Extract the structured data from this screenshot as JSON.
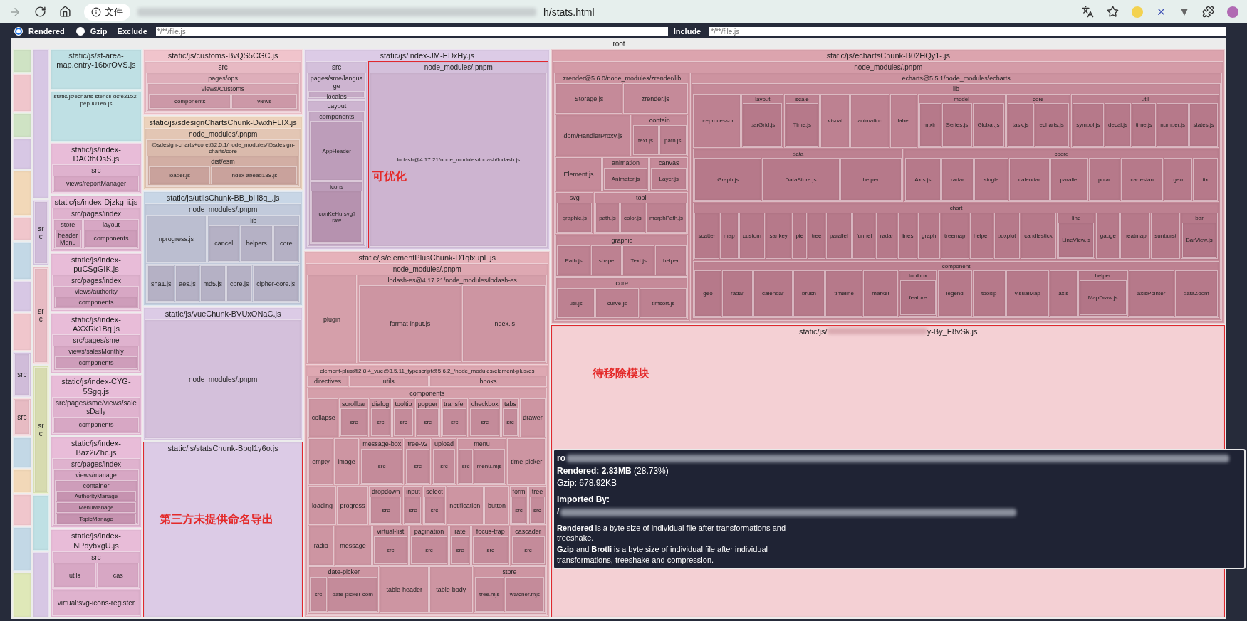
{
  "browser": {
    "scheme_label": "文件",
    "url_end": "h/stats.html"
  },
  "controls": {
    "modes": [
      {
        "label": "Rendered",
        "selected": true
      },
      {
        "label": "Gzip",
        "selected": false
      }
    ],
    "exclude": {
      "label": "Exclude",
      "placeholder": "*/**/file.js"
    },
    "include": {
      "label": "Include",
      "placeholder": "*/**/file.js"
    }
  },
  "treemap": {
    "name": "root",
    "children": [
      {
        "color": "#cfe3c4"
      },
      {
        "color": "#f0c6cc"
      },
      {
        "color": "#cfe3c4"
      },
      {
        "color": "#d7c7e4"
      },
      {
        "color": "#f2d8b8"
      },
      {
        "color": "#f0c6cc"
      },
      {
        "color": "#c3d8e6"
      },
      {
        "color": "#d7c7e4"
      },
      {
        "color": "#f0c6cc"
      },
      {
        "color": "#d7c7e4",
        "children": [
          {
            "name": "src"
          }
        ]
      },
      {
        "color": "#f0c6cc",
        "children": [
          {
            "name": "src"
          }
        ]
      },
      {
        "color": "#c3d8e6"
      },
      {
        "color": "#f2d8b8"
      },
      {
        "color": "#f0c6cc"
      },
      {
        "color": "#c3d8e6"
      },
      {
        "color": "#dfe8b8"
      },
      {
        "color": "#d7c7e4"
      },
      {
        "color": "#d7c7e4",
        "children": [
          {
            "name": "src"
          }
        ]
      },
      {
        "color": "#f0c6cc",
        "children": [
          {
            "name": "src"
          }
        ]
      },
      {
        "color": "#dfe8b8",
        "children": [
          {
            "name": "src"
          }
        ]
      },
      {
        "color": "#bfe0e4"
      },
      {
        "color": "#d7c7e4"
      },
      {
        "name": "static/js/sf-area-map.entry-16txrOVS.js",
        "color": "#bfe0e4"
      },
      {
        "name": "static/js/echarts-stencil-dcfe3152-pep0U1e6.js",
        "color": "#bfe0e4"
      },
      {
        "name": "static/js/index-DACfhOsS.js",
        "color": "#e8bcd8",
        "children": [
          {
            "name": "src",
            "children": [
              {
                "name": "views/reportManager"
              }
            ]
          }
        ]
      },
      {
        "name": "static/js/index-Djzkg-ii.js",
        "color": "#e8bcd8",
        "children": [
          {
            "name": "src/pages/index",
            "children": [
              {
                "name": "store",
                "children": [
                  {
                    "name": "headerMenu"
                  }
                ]
              },
              {
                "name": "layout",
                "children": [
                  {
                    "name": "components"
                  }
                ]
              }
            ]
          }
        ]
      },
      {
        "name": "static/js/index-puCSgGIK.js",
        "color": "#e8bcd8",
        "children": [
          {
            "name": "src/pages/index",
            "children": [
              {
                "name": "views/authority",
                "children": [
                  {
                    "name": "components"
                  }
                ]
              }
            ]
          }
        ]
      },
      {
        "name": "static/js/index-AXXRk1Bq.js",
        "color": "#e8bcd8",
        "children": [
          {
            "name": "src/pages/sme",
            "children": [
              {
                "name": "views/salesMonthly",
                "children": [
                  {
                    "name": "components"
                  }
                ]
              }
            ]
          }
        ]
      },
      {
        "name": "static/js/index-CYG-5Sgq.js",
        "color": "#e8bcd8",
        "children": [
          {
            "name": "src/pages/sme/views/salesDaily",
            "children": [
              {
                "name": "components"
              }
            ]
          }
        ]
      },
      {
        "name": "static/js/index-Baz2iZhc.js",
        "color": "#e8bcd8",
        "children": [
          {
            "name": "src/pages/index",
            "children": [
              {
                "name": "views/manage",
                "children": [
                  {
                    "name": "container",
                    "children": [
                      {
                        "name": "AuthorityManage"
                      },
                      {
                        "name": "MenuManage"
                      },
                      {
                        "name": "TopicManage"
                      }
                    ]
                  }
                ]
              }
            ]
          }
        ]
      },
      {
        "name": "static/js/index-NPdybxgU.js",
        "color": "#e8bcd8",
        "children": [
          {
            "name": "src",
            "children": [
              {
                "name": "utils"
              },
              {
                "name": "cas"
              }
            ]
          },
          {
            "name": "virtual:svg-icons-register"
          }
        ]
      },
      {
        "name": "static/js/customs-BvQS5CGC.js",
        "color": "#f0c4cc",
        "children": [
          {
            "name": "src",
            "children": [
              {
                "name": "pages/ops",
                "children": [
                  {
                    "name": "views/Customs",
                    "children": [
                      {
                        "name": "components"
                      },
                      {
                        "name": "views"
                      }
                    ]
                  }
                ]
              }
            ]
          }
        ]
      },
      {
        "name": "static/js/sdesignChartsChunk-DwxhFLIX.js",
        "color": "#ecd2bc",
        "children": [
          {
            "name": "node_modules/.pnpm",
            "children": [
              {
                "name": "@sdesign-charts+core@2.5.1/node_modules/@sdesign-charts/core",
                "children": [
                  {
                    "name": "dist/esm",
                    "children": [
                      {
                        "name": "loader.js"
                      },
                      {
                        "name": "index-abead138.js"
                      }
                    ]
                  }
                ]
              }
            ]
          }
        ]
      },
      {
        "name": "static/js/utilsChunk-BB_bH8q_.js",
        "color": "#c8d6e6",
        "children": [
          {
            "name": "node_modules/.pnpm",
            "children": [
              {
                "name": "nprogress.js"
              },
              {
                "name": "lib",
                "children": [
                  {
                    "name": "cancel"
                  },
                  {
                    "name": "helpers"
                  },
                  {
                    "name": "core"
                  }
                ]
              },
              {
                "children": [
                  {
                    "name": "sha1.js"
                  },
                  {
                    "name": "aes.js"
                  },
                  {
                    "name": "md5.js"
                  },
                  {
                    "name": "core.js"
                  },
                  {
                    "name": "cipher-core.js"
                  }
                ]
              }
            ]
          }
        ]
      },
      {
        "name": "static/js/vueChunk-BVUxONaC.js",
        "color": "#dccbe6",
        "children": [
          {
            "name": "node_modules/.pnpm"
          }
        ]
      },
      {
        "name": "static/js/statsChunk-Bpql1y6o.js",
        "color": "#dccbe6",
        "highlighted": true,
        "note": "第三方未提供命名导出"
      },
      {
        "name": "static/js/index-JM-EDxHy.js",
        "color": "#dccbe6",
        "children": [
          {
            "name": "src",
            "children": [
              {
                "name": "pages/sme/language",
                "children": [
                  {
                    "name": "locales"
                  }
                ]
              },
              {
                "name": "Layout",
                "children": [
                  {
                    "name": "components",
                    "children": [
                      {
                        "name": "AppHeader"
                      },
                      {
                        "name": "icons",
                        "children": [
                          {
                            "name": "iconKeHu.svg?raw"
                          }
                        ]
                      }
                    ]
                  }
                ]
              }
            ]
          },
          {
            "name": "node_modules/.pnpm",
            "highlighted": true,
            "note": "可优化",
            "children": [
              {
                "name": "lodash@4.17.21/node_modules/lodash/lodash.js"
              }
            ]
          }
        ]
      },
      {
        "name": "static/js/elementPlusChunk-D1qlxupF.js",
        "color": "#e6b2ba",
        "children": [
          {
            "name": "node_modules/.pnpm",
            "children": [
              {
                "name": "plugin"
              },
              {
                "name": "lodash-es@4.17.21/node_modules/lodash-es",
                "children": [
                  {
                    "name": "format-input.js"
                  },
                  {
                    "name": "index.js"
                  }
                ]
              }
            ]
          },
          {
            "name": "element-plus@2.8.4_vue@3.5.11_typescript@5.6.2_/node_modules/element-plus/es",
            "children": [
              {
                "name": "directives"
              },
              {
                "name": "utils"
              },
              {
                "name": "hooks"
              },
              {
                "name": "components",
                "children": [
                  {
                    "name": "collapse"
                  },
                  {
                    "name": "scrollbar",
                    "children": [
                      {
                        "name": "src"
                      }
                    ]
                  },
                  {
                    "name": "dialog",
                    "children": [
                      {
                        "name": "src"
                      }
                    ]
                  },
                  {
                    "name": "tooltip",
                    "children": [
                      {
                        "name": "src"
                      }
                    ]
                  },
                  {
                    "name": "popper",
                    "children": [
                      {
                        "name": "src"
                      }
                    ]
                  },
                  {
                    "name": "transfer",
                    "children": [
                      {
                        "name": "src"
                      }
                    ]
                  },
                  {
                    "name": "checkbox",
                    "children": [
                      {
                        "name": "src"
                      }
                    ]
                  },
                  {
                    "name": "tabs",
                    "children": [
                      {
                        "name": "src"
                      }
                    ]
                  },
                  {
                    "name": "drawer"
                  },
                  {
                    "name": "empty"
                  },
                  {
                    "name": "image"
                  },
                  {
                    "name": "message-box",
                    "children": [
                      {
                        "name": "src"
                      }
                    ]
                  },
                  {
                    "name": "tree-v2",
                    "children": [
                      {
                        "name": "src"
                      }
                    ]
                  },
                  {
                    "name": "upload",
                    "children": [
                      {
                        "name": "src"
                      }
                    ]
                  },
                  {
                    "name": "menu",
                    "children": [
                      {
                        "name": "src"
                      },
                      {
                        "name": "menu.mjs"
                      }
                    ]
                  },
                  {
                    "name": "time-picker"
                  },
                  {
                    "name": "loading"
                  },
                  {
                    "name": "progress"
                  },
                  {
                    "name": "dropdown",
                    "children": [
                      {
                        "name": "src"
                      }
                    ]
                  },
                  {
                    "name": "input",
                    "children": [
                      {
                        "name": "src"
                      }
                    ]
                  },
                  {
                    "name": "select",
                    "children": [
                      {
                        "name": "src"
                      }
                    ]
                  },
                  {
                    "name": "notification"
                  },
                  {
                    "name": "button"
                  },
                  {
                    "name": "form",
                    "children": [
                      {
                        "name": "src"
                      }
                    ]
                  },
                  {
                    "name": "tree",
                    "children": [
                      {
                        "name": "src"
                      }
                    ]
                  },
                  {
                    "name": "radio"
                  },
                  {
                    "name": "message"
                  },
                  {
                    "name": "virtual-list",
                    "children": [
                      {
                        "name": "src"
                      }
                    ]
                  },
                  {
                    "name": "pagination",
                    "children": [
                      {
                        "name": "src"
                      }
                    ]
                  },
                  {
                    "name": "rate",
                    "children": [
                      {
                        "name": "src"
                      }
                    ]
                  },
                  {
                    "name": "focus-trap",
                    "children": [
                      {
                        "name": "src"
                      }
                    ]
                  },
                  {
                    "name": "cascader",
                    "children": [
                      {
                        "name": "src"
                      }
                    ]
                  },
                  {
                    "name": "date-picker",
                    "children": [
                      {
                        "name": "src"
                      },
                      {
                        "name": "date-picker-com"
                      }
                    ]
                  },
                  {
                    "name": "table-header"
                  },
                  {
                    "name": "table-body"
                  },
                  {
                    "name": "store",
                    "children": [
                      {
                        "name": "tree.mjs"
                      },
                      {
                        "name": "watcher.mjs"
                      }
                    ]
                  }
                ]
              }
            ]
          }
        ]
      },
      {
        "name": "static/js/echartsChunk-B02HQy1-.js",
        "color": "#dca4ae",
        "children": [
          {
            "name": "node_modules/.pnpm",
            "children": [
              {
                "name": "zrender@5.6.0/node_modules/zrender/lib",
                "children": [
                  {
                    "name": "Storage.js"
                  },
                  {
                    "name": "zrender.js"
                  },
                  {
                    "name": "dom/HandlerProxy.js"
                  },
                  {
                    "name": "contain",
                    "children": [
                      {
                        "name": "text.js"
                      },
                      {
                        "name": "path.js"
                      }
                    ]
                  },
                  {
                    "name": "Element.js"
                  },
                  {
                    "name": "animation",
                    "children": [
                      {
                        "name": "Animator.js"
                      }
                    ]
                  },
                  {
                    "name": "canvas",
                    "children": [
                      {
                        "name": "Layer.js"
                      }
                    ]
                  },
                  {
                    "name": "svg",
                    "children": [
                      {
                        "name": "graphic.js"
                      }
                    ]
                  },
                  {
                    "name": "tool",
                    "children": [
                      {
                        "name": "path.js"
                      },
                      {
                        "name": "color.js"
                      },
                      {
                        "name": "morphPath.js"
                      }
                    ]
                  },
                  {
                    "name": "graphic",
                    "children": [
                      {
                        "name": "Path.js"
                      },
                      {
                        "name": "shape"
                      },
                      {
                        "name": "Text.js"
                      },
                      {
                        "name": "helper"
                      }
                    ]
                  },
                  {
                    "name": "core",
                    "children": [
                      {
                        "name": "util.js"
                      },
                      {
                        "name": "curve.js"
                      },
                      {
                        "name": "timsort.js"
                      }
                    ]
                  }
                ]
              },
              {
                "name": "echarts@5.5.1/node_modules/echarts",
                "children": [
                  {
                    "name": "lib",
                    "children": [
                      {
                        "name": "preprocessor"
                      },
                      {
                        "name": "layout",
                        "children": [
                          {
                            "name": "barGrid.js"
                          }
                        ]
                      },
                      {
                        "name": "scale",
                        "children": [
                          {
                            "name": "Time.js"
                          }
                        ]
                      },
                      {
                        "name": "visual"
                      },
                      {
                        "name": "animation"
                      },
                      {
                        "name": "label"
                      },
                      {
                        "name": "model",
                        "children": [
                          {
                            "name": "mixin"
                          },
                          {
                            "name": "Series.js"
                          },
                          {
                            "name": "Global.js"
                          }
                        ]
                      },
                      {
                        "name": "core",
                        "children": [
                          {
                            "name": "task.js"
                          },
                          {
                            "name": "echarts.js"
                          }
                        ]
                      },
                      {
                        "name": "util",
                        "children": [
                          {
                            "name": "symbol.js"
                          },
                          {
                            "name": "decal.js"
                          },
                          {
                            "name": "time.js"
                          },
                          {
                            "name": "number.js"
                          },
                          {
                            "name": "states.js"
                          }
                        ]
                      },
                      {
                        "name": "data",
                        "children": [
                          {
                            "name": "Graph.js"
                          },
                          {
                            "name": "DataStore.js"
                          },
                          {
                            "name": "helper"
                          }
                        ]
                      },
                      {
                        "name": "coord",
                        "children": [
                          {
                            "name": "Axis.js"
                          },
                          {
                            "name": "radar"
                          },
                          {
                            "name": "single"
                          },
                          {
                            "name": "calendar"
                          },
                          {
                            "name": "parallel"
                          },
                          {
                            "name": "polar"
                          },
                          {
                            "name": "cartesian"
                          },
                          {
                            "name": "geo"
                          },
                          {
                            "name": "fix"
                          }
                        ]
                      },
                      {
                        "name": "chart",
                        "children": [
                          {
                            "name": "scatter"
                          },
                          {
                            "name": "map"
                          },
                          {
                            "name": "custom"
                          },
                          {
                            "name": "sankey"
                          },
                          {
                            "name": "pie"
                          },
                          {
                            "name": "tree"
                          },
                          {
                            "name": "parallel"
                          },
                          {
                            "name": "funnel"
                          },
                          {
                            "name": "radar"
                          },
                          {
                            "name": "lines"
                          },
                          {
                            "name": "graph"
                          },
                          {
                            "name": "treemap"
                          },
                          {
                            "name": "helper"
                          },
                          {
                            "name": "boxplot"
                          },
                          {
                            "name": "candlestick"
                          },
                          {
                            "name": "line",
                            "children": [
                              {
                                "name": "LineView.js"
                              }
                            ]
                          },
                          {
                            "name": "gauge"
                          },
                          {
                            "name": "heatmap"
                          },
                          {
                            "name": "sunburst"
                          },
                          {
                            "name": "bar",
                            "children": [
                              {
                                "name": "BarView.js"
                              }
                            ]
                          }
                        ]
                      },
                      {
                        "name": "component",
                        "children": [
                          {
                            "name": "geo"
                          },
                          {
                            "name": "radar"
                          },
                          {
                            "name": "calendar"
                          },
                          {
                            "name": "brush"
                          },
                          {
                            "name": "timeline"
                          },
                          {
                            "name": "marker"
                          },
                          {
                            "name": "toolbox",
                            "children": [
                              {
                                "name": "feature"
                              }
                            ]
                          },
                          {
                            "name": "legend"
                          },
                          {
                            "name": "tooltip"
                          },
                          {
                            "name": "visualMap"
                          },
                          {
                            "name": "axis"
                          },
                          {
                            "name": "helper",
                            "children": [
                              {
                                "name": "MapDraw.js"
                              }
                            ]
                          },
                          {
                            "name": "axisPointer"
                          },
                          {
                            "name": "dataZoom"
                          }
                        ]
                      }
                    ]
                  }
                ]
              }
            ]
          }
        ]
      },
      {
        "name": "static/js/",
        "name_end": "y-By_E8vSk.js",
        "color": "#f4d0d4",
        "highlighted": true,
        "note": "待移除模块"
      }
    ]
  },
  "tooltip": {
    "path_start": "ro",
    "rendered": "**Rendered: 2.83MB** (28.73%)",
    "gzip": "Gzip: 678.92KB",
    "imported_heading": "Imported By:",
    "importer_start": "/",
    "notes": [
      "**Rendered** is a byte size of individual file after transformations and treeshake.",
      "**Gzip** and **Brotli** is a byte size of individual file after individual transformations, treeshake and compression."
    ]
  }
}
